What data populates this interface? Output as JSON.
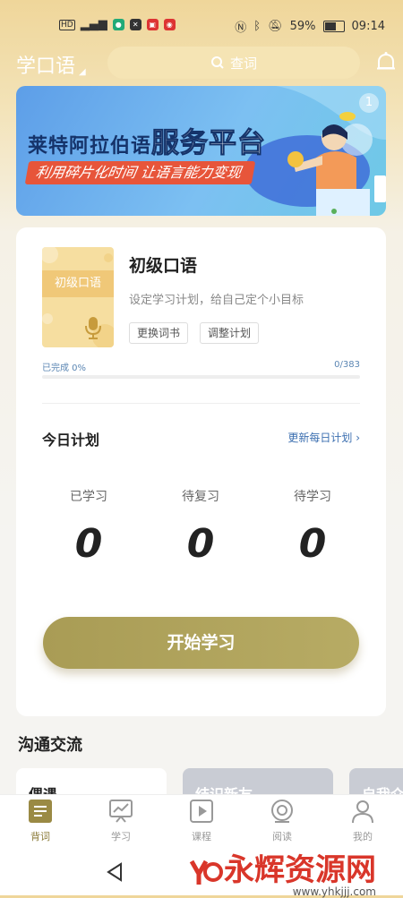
{
  "status_bar": {
    "battery": "59%",
    "time": "09:14",
    "carrier": "HD"
  },
  "header": {
    "brand": "学口语",
    "search_placeholder": "查词"
  },
  "banner": {
    "title_main": "莱特阿拉伯语",
    "title_big": "服务平台",
    "subtitle": "利用碎片化时间 让语言能力变现",
    "page_index": "1"
  },
  "book": {
    "cover_label": "初级口语",
    "title": "初级口语",
    "desc": "设定学习计划，给自己定个小目标",
    "change_btn": "更换词书",
    "adjust_btn": "调整计划",
    "progress_label": "已完成 0%",
    "progress_count": "0/383",
    "progress_fraction": 0
  },
  "today": {
    "title": "今日计划",
    "update_link": "更新每日计划",
    "stats": [
      {
        "label": "已学习",
        "value": "0"
      },
      {
        "label": "待复习",
        "value": "0"
      },
      {
        "label": "待学习",
        "value": "0"
      }
    ],
    "start_btn": "开始学习"
  },
  "section": {
    "title": "沟通交流",
    "tiles": [
      "偶遇",
      "结识新友",
      "自我介"
    ]
  },
  "nav": [
    {
      "label": "背词",
      "icon": "book-icon",
      "active": true
    },
    {
      "label": "学习",
      "icon": "chart-board-icon",
      "active": false
    },
    {
      "label": "课程",
      "icon": "play-icon",
      "active": false
    },
    {
      "label": "阅读",
      "icon": "read-icon",
      "active": false
    },
    {
      "label": "我的",
      "icon": "person-icon",
      "active": false
    }
  ],
  "watermark": {
    "text": "永辉资源网",
    "url": "www.yhkjjj.com"
  },
  "colors": {
    "accent": "#b0a35f",
    "link": "#3c6fb0",
    "banner": "#6aaeea"
  }
}
